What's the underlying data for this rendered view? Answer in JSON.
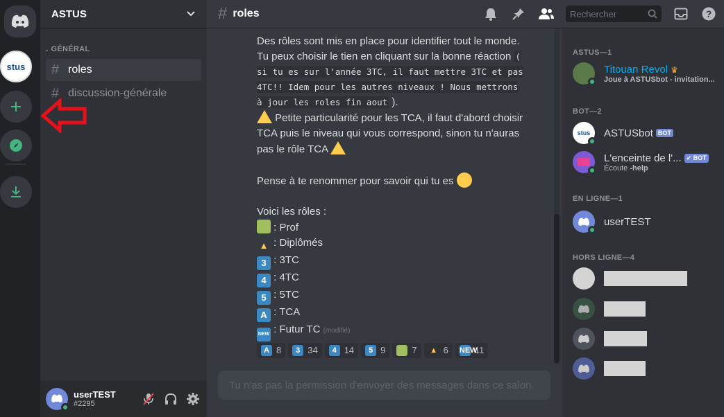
{
  "server": {
    "name": "ASTUS",
    "avatar_text": "stus"
  },
  "sidebar": {
    "category": "GÉNÉRAL",
    "channels": [
      {
        "label": "roles",
        "active": true
      },
      {
        "label": "discussion-générale",
        "active": false
      }
    ]
  },
  "user": {
    "name": "userTEST",
    "discriminator": "#2295"
  },
  "topbar": {
    "channel": "roles",
    "search_placeholder": "Rechercher"
  },
  "message": {
    "p1_a": "Des rôles sont mis en place pour identifier tout le monde. Tu peux choisir le tien en cliquant sur la bonne réaction ",
    "p1_code": "( si tu es sur l'année 3TC, il faut mettre 3TC et pas 4TC!! Idem pour les autres niveaux ! Nous mettrons à jour les roles fin aout",
    "p1_end": " ).",
    "p2": " Petite particularité pour les TCA, il faut d'abord choisir TCA puis le niveau qui vous correspond, sinon tu n'auras pas le rôle TCA ",
    "p3": "Pense à te renommer pour savoir qui tu es",
    "p4": "Voici les rôles :",
    "roles": [
      {
        "emoji": "prof",
        "label": " : Prof"
      },
      {
        "emoji": "grad",
        "label": " : Diplômés"
      },
      {
        "emoji": "3",
        "label": " : 3TC"
      },
      {
        "emoji": "4",
        "label": " : 4TC"
      },
      {
        "emoji": "5",
        "label": " : 5TC"
      },
      {
        "emoji": "A",
        "label": " : TCA"
      },
      {
        "emoji": "NEW",
        "label": " : Futur TC"
      }
    ],
    "edited": "(modifié)",
    "reactions": [
      {
        "emoji": "A",
        "count": "8"
      },
      {
        "emoji": "3",
        "count": "34"
      },
      {
        "emoji": "4",
        "count": "14"
      },
      {
        "emoji": "5",
        "count": "9"
      },
      {
        "emoji": "prof",
        "count": "7"
      },
      {
        "emoji": "grad",
        "count": "6"
      },
      {
        "emoji": "NEW",
        "count": "11"
      }
    ]
  },
  "input": {
    "placeholder": "Tu n'as pas la permission d'envoyer des messages dans ce salon."
  },
  "members": {
    "cat_astus": "ASTUS—1",
    "cat_bot": "BOT—2",
    "cat_online": "EN LIGNE—1",
    "cat_offline": "HORS LIGNE—4",
    "owner": {
      "name": "Titouan Revol",
      "status": "Joue à ASTUSbot - invitation..."
    },
    "bot1": {
      "name": "ASTUSbot",
      "badge": "BOT"
    },
    "bot2": {
      "name": "L'enceinte de l'...",
      "badge": "✔ BOT",
      "status_a": "Écoute ",
      "status_b": "-help"
    },
    "online_user": {
      "name": "userTEST"
    }
  },
  "colors": {
    "accent": "#7289da",
    "online": "#43b581",
    "annotation": "#e8111b"
  }
}
